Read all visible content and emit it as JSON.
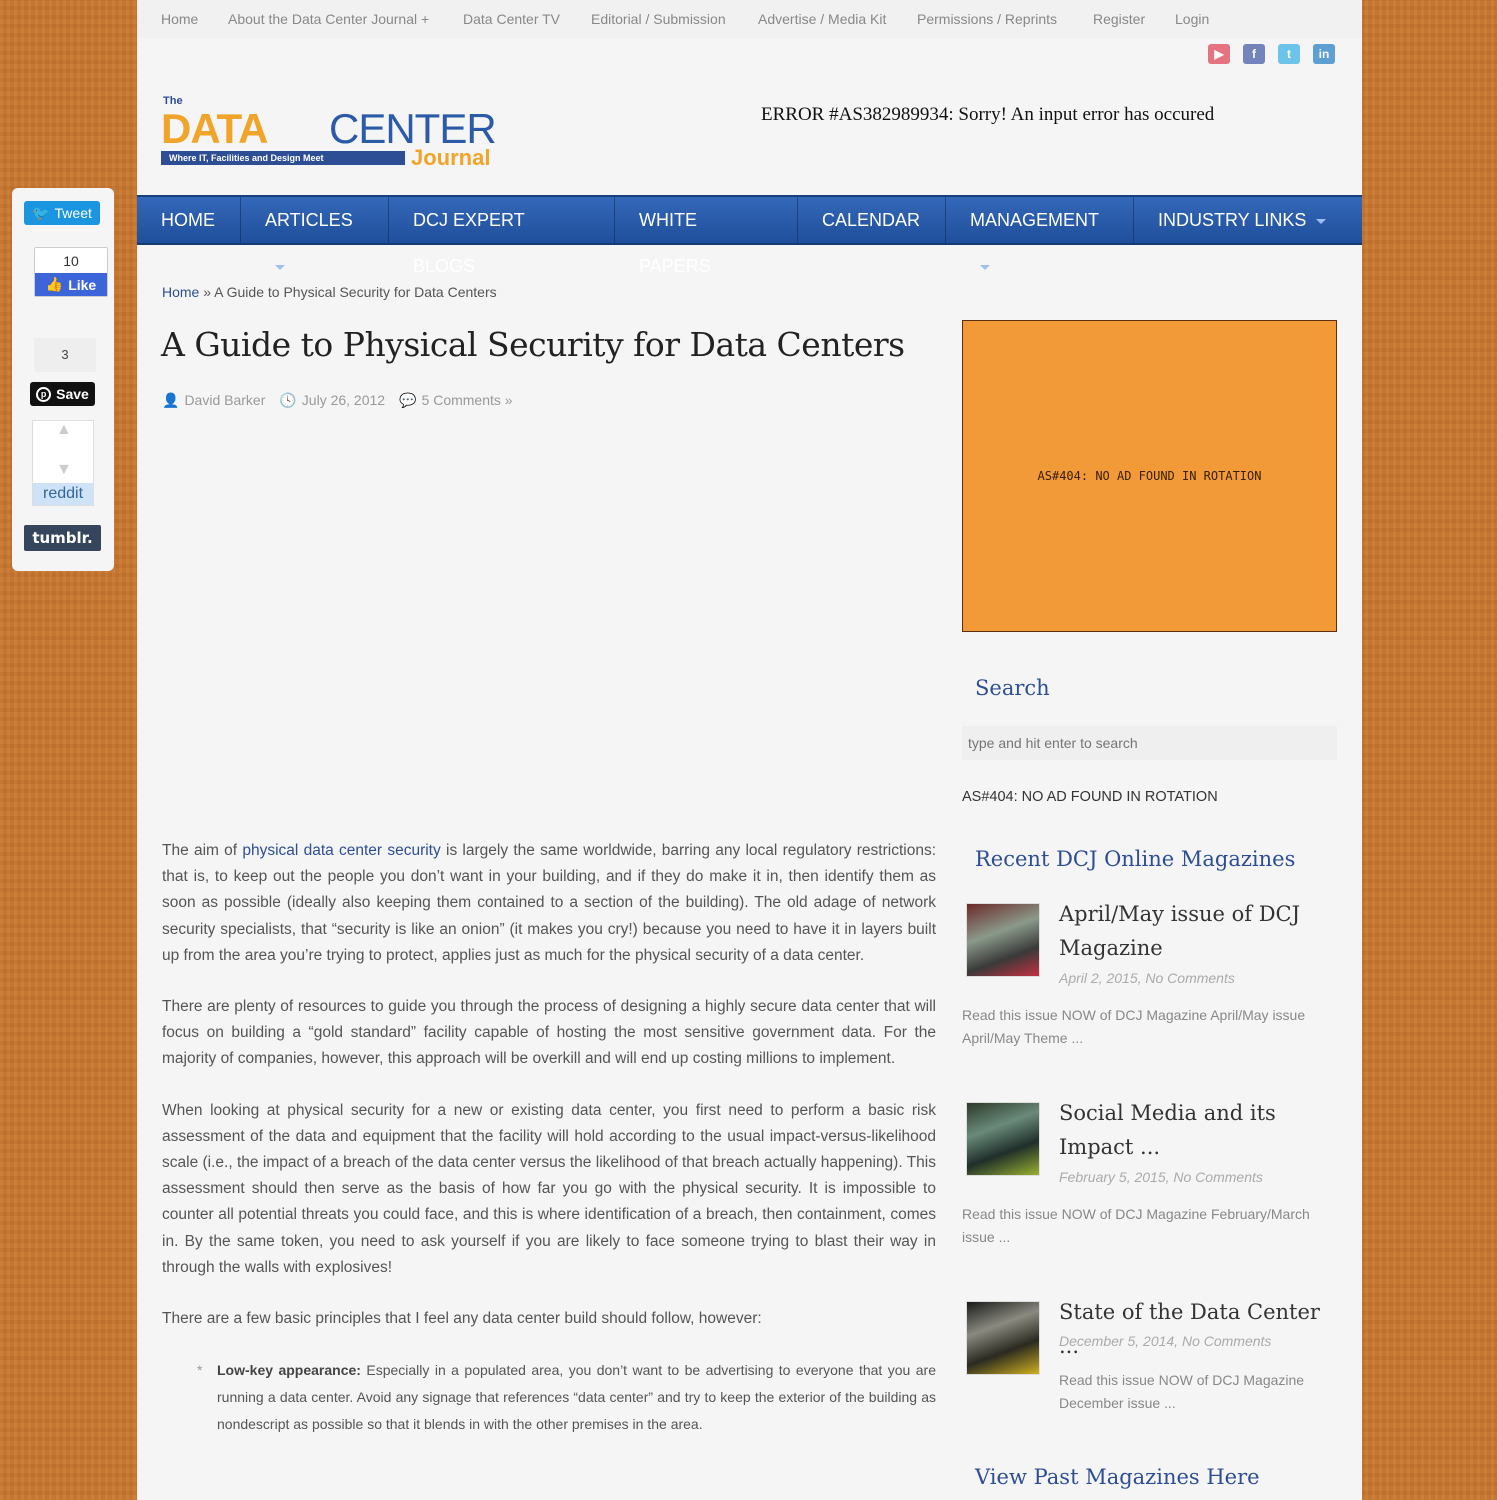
{
  "top_nav": [
    "Home",
    "About the Data Center Journal +",
    "Data Center TV",
    "Editorial / Submission",
    "Advertise / Media Kit",
    "Permissions / Reprints",
    "Register",
    "Login"
  ],
  "social_top": [
    {
      "icon": "youtube-icon",
      "glyph": "▶",
      "color": "#e04a5a"
    },
    {
      "icon": "facebook-icon",
      "glyph": "f",
      "color": "#4a5ea8"
    },
    {
      "icon": "twitter-icon",
      "glyph": "t",
      "color": "#3fb4e8"
    },
    {
      "icon": "linkedin-icon",
      "glyph": "in",
      "color": "#2a83c4"
    }
  ],
  "logo": {
    "the": "The",
    "data": "DATA",
    "center": "CENTER",
    "tagline": "Where IT, Facilities and Design Meet",
    "journal": "Journal"
  },
  "header_error": "ERROR #AS382989934: Sorry! An input error has occured",
  "main_nav": [
    {
      "label": "HOME",
      "dropdown": false
    },
    {
      "label": "ARTICLES",
      "dropdown": true
    },
    {
      "label": "DCJ EXPERT BLOGS",
      "dropdown": false
    },
    {
      "label": "WHITE PAPERS",
      "dropdown": false
    },
    {
      "label": "CALENDAR",
      "dropdown": false
    },
    {
      "label": "MANAGEMENT",
      "dropdown": true
    },
    {
      "label": "INDUSTRY LINKS",
      "dropdown": true
    }
  ],
  "breadcrumb": {
    "home": "Home",
    "separator": "»",
    "current": "A Guide to Physical Security for Data Centers"
  },
  "article": {
    "title": "A Guide to Physical Security for Data Centers",
    "author": "David Barker",
    "date": "July 26, 2012",
    "comments": "5 Comments »",
    "p1_before": "The aim of ",
    "p1_link": "physical data center security",
    "p1_after": " is largely the same worldwide, barring any local regulatory restrictions: that is, to keep out the people you don’t want in your building, and if they do make it in, then identify them as soon as possible (ideally also keeping them contained to a section of the building). The old adage of network security specialists, that “security is like an onion” (it makes you cry!) because you need to have it in layers built up from the area you’re trying to protect, applies just as much for the physical security of a data center.",
    "p2": "There are plenty of resources to guide you through the process of designing a highly secure data center that will focus on building a “gold standard” facility capable of hosting the most sensitive government data. For the majority of companies, however, this approach will be overkill and will end up costing millions to implement.",
    "p3": "When looking at physical security for a new or existing data center, you first need to perform a basic risk assessment of the data and equipment that the facility will hold according to the usual impact-versus-likelihood scale (i.e., the impact of a breach of the data center versus the likelihood of that breach actually happening). This assessment should then serve as the basis of how far you go with the physical security. It is impossible to counter all potential threats you could face, and this is where identification of a breach, then containment, comes in. By the same token, you need to ask yourself if you are likely to face someone trying to blast their way in through the walls with explosives!",
    "p4": "There are a few basic principles that I feel any data center build should follow, however:",
    "bullets": [
      {
        "bold": "Low-key appearance:",
        "text": " Especially in a populated area, you don’t want to be advertising to everyone that you are running a data center. Avoid any signage that references “data center” and try to keep the exterior of the building as nondescript as possible so that it blends in with the other premises in the area."
      }
    ]
  },
  "sidebar": {
    "ad_text": "AS#404: NO AD FOUND IN ROTATION",
    "search_title": "Search",
    "search_placeholder": "type and hit enter to search",
    "side_ad_text": "AS#404: NO AD FOUND IN ROTATION",
    "magazines_title": "Recent DCJ Online Magazines",
    "magazines": [
      {
        "title": "April/May issue of DCJ Magazine",
        "meta": "April 2, 2015, No Comments",
        "desc": "Read this issue NOW of DCJ Magazine April/May issue  April/May Theme ..."
      },
      {
        "title": "Social Media and its Impact ...",
        "meta": "February 5, 2015, No Comments",
        "desc": "Read this issue NOW of DCJ Magazine February/March issue     ..."
      },
      {
        "title": "State of the Data Center ...",
        "meta": "December 5, 2014, No Comments",
        "desc": "Read this issue NOW of DCJ Magazine December issue     ..."
      }
    ],
    "past_title": "View Past Magazines Here"
  },
  "share": {
    "tweet": "Tweet",
    "like_count": "10",
    "like": "Like",
    "pin_count": "3",
    "save": "Save",
    "reddit": "reddit",
    "tumblr": "tumblr."
  }
}
